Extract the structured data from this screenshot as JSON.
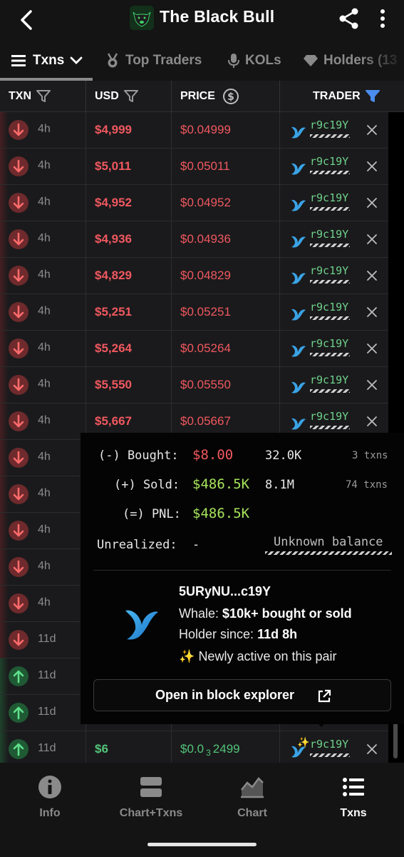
{
  "header": {
    "title": "The Black Bull"
  },
  "tabs": [
    {
      "label": "Txns",
      "active": true
    },
    {
      "label": "Top Traders",
      "active": false
    },
    {
      "label": "KOLs",
      "active": false
    },
    {
      "label": "Holders (13",
      "active": false
    }
  ],
  "table": {
    "columns": {
      "txn": "TXN",
      "usd": "USD",
      "price": "PRICE",
      "trader": "TRADER"
    },
    "rows": [
      {
        "type": "sell",
        "age": "4h",
        "usd": "$4,999",
        "price": "$0.04999",
        "trader": "r9c19Y"
      },
      {
        "type": "sell",
        "age": "4h",
        "usd": "$5,011",
        "price": "$0.05011",
        "trader": "r9c19Y"
      },
      {
        "type": "sell",
        "age": "4h",
        "usd": "$4,952",
        "price": "$0.04952",
        "trader": "r9c19Y"
      },
      {
        "type": "sell",
        "age": "4h",
        "usd": "$4,936",
        "price": "$0.04936",
        "trader": "r9c19Y"
      },
      {
        "type": "sell",
        "age": "4h",
        "usd": "$4,829",
        "price": "$0.04829",
        "trader": "r9c19Y"
      },
      {
        "type": "sell",
        "age": "4h",
        "usd": "$5,251",
        "price": "$0.05251",
        "trader": "r9c19Y"
      },
      {
        "type": "sell",
        "age": "4h",
        "usd": "$5,264",
        "price": "$0.05264",
        "trader": "r9c19Y"
      },
      {
        "type": "sell",
        "age": "4h",
        "usd": "$5,550",
        "price": "$0.05550",
        "trader": "r9c19Y"
      },
      {
        "type": "sell",
        "age": "4h",
        "usd": "$5,667",
        "price": "$0.05667",
        "trader": "r9c19Y"
      },
      {
        "type": "sell",
        "age": "4h"
      },
      {
        "type": "sell",
        "age": "4h"
      },
      {
        "type": "sell",
        "age": "4h"
      },
      {
        "type": "sell",
        "age": "4h"
      },
      {
        "type": "sell",
        "age": "4h"
      },
      {
        "type": "sell",
        "age": "11d"
      },
      {
        "type": "buy",
        "age": "11d"
      },
      {
        "type": "buy",
        "age": "11d"
      },
      {
        "type": "buy",
        "age": "11d",
        "usd": "$6",
        "price_prefix": "$0.0",
        "price_sub": "3",
        "price_suffix": "2499",
        "trader": "r9c19Y",
        "sparkle": true
      }
    ]
  },
  "popover": {
    "bought_label": "(-) Bought:",
    "bought_usd": "$8.00",
    "bought_tokens": "32.0K",
    "bought_txns": "3 txns",
    "sold_label": "(+) Sold:",
    "sold_usd": "$486.5K",
    "sold_tokens": "8.1M",
    "sold_txns": "74 txns",
    "pnl_label": "(=) PNL:",
    "pnl_usd": "$486.5K",
    "unrealized_label": "Unrealized:",
    "unrealized_value": "-",
    "unknown_balance": "Unknown balance",
    "wallet": "5URyNU...c19Y",
    "whale_prefix": "Whale:",
    "whale_value": "$10k+ bought or sold",
    "holder_prefix": "Holder since:",
    "holder_value": "11d 8h",
    "newly_active": "Newly active on this pair",
    "explorer_button": "Open in block explorer"
  },
  "bottom_nav": [
    {
      "label": "Info",
      "icon": "info-icon",
      "active": false
    },
    {
      "label": "Chart+Txns",
      "icon": "split-view-icon",
      "active": false
    },
    {
      "label": "Chart",
      "icon": "chart-icon",
      "active": false
    },
    {
      "label": "Txns",
      "icon": "list-icon",
      "active": true
    }
  ],
  "colors": {
    "sell": "#f0585f",
    "buy": "#52c47a",
    "trader": "#6fd18a",
    "accent_filter": "#4a8cf0",
    "pnl": "#a6e35c"
  }
}
